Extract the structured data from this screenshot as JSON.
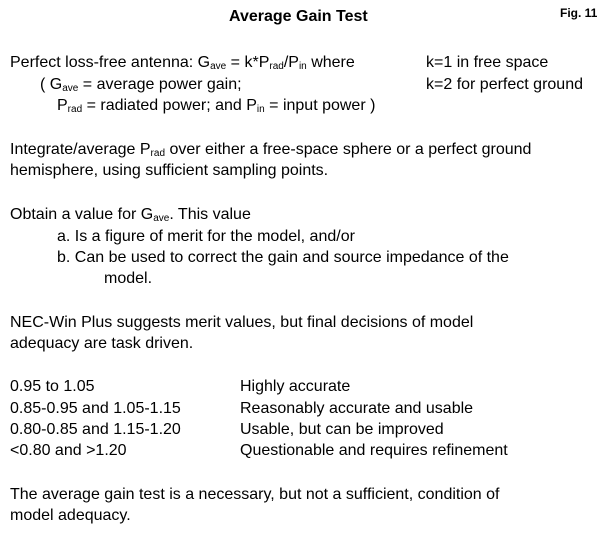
{
  "title": "Average Gain Test",
  "fig_label": "Fig. 11",
  "formula": {
    "line1_a": "Perfect loss-free antenna: G",
    "line1_sub_ave": "ave",
    "line1_b": " = k*P",
    "line1_sub_rad": "rad",
    "line1_c": "/P",
    "line1_sub_in": "in",
    "line1_d": " where",
    "k_free": "k=1 in free space",
    "line2_a": "( G",
    "line2_sub_ave": "ave",
    "line2_b": " = average power gain;",
    "k_ground": "k=2 for perfect ground",
    "line3_a": "P",
    "line3_sub_rad": "rad",
    "line3_b": " = radiated power; and P",
    "line3_sub_in": "in",
    "line3_c": " = input power  )"
  },
  "integrate": {
    "line1_a": "Integrate/average P",
    "line1_sub": "rad",
    "line1_b": " over either a free-space sphere or a perfect ground",
    "line2": "hemisphere, using sufficient sampling points."
  },
  "obtain": {
    "line1_a": "Obtain a value for G",
    "line1_sub": "ave",
    "line1_b": ".  This value",
    "item_a": "a.  Is a figure of merit for the model, and/or",
    "item_b1": "b.  Can be used to correct the gain and source impedance of the",
    "item_b2": "model."
  },
  "necwin": {
    "line1": "NEC-Win Plus suggests merit values, but final decisions of model",
    "line2": "adequacy are task driven."
  },
  "merit_table": [
    {
      "range": "0.95 to 1.05",
      "rating": "Highly accurate"
    },
    {
      "range": "0.85-0.95 and 1.05-1.15",
      "rating": "Reasonably accurate and usable"
    },
    {
      "range": "0.80-0.85 and 1.15-1.20",
      "rating": "Usable, but can be improved"
    },
    {
      "range": "<0.80 and >1.20",
      "rating": "Questionable and requires refinement"
    }
  ],
  "conclusion": {
    "line1": "The average gain test is a necessary, but not a sufficient, condition of",
    "line2": "model adequacy."
  }
}
